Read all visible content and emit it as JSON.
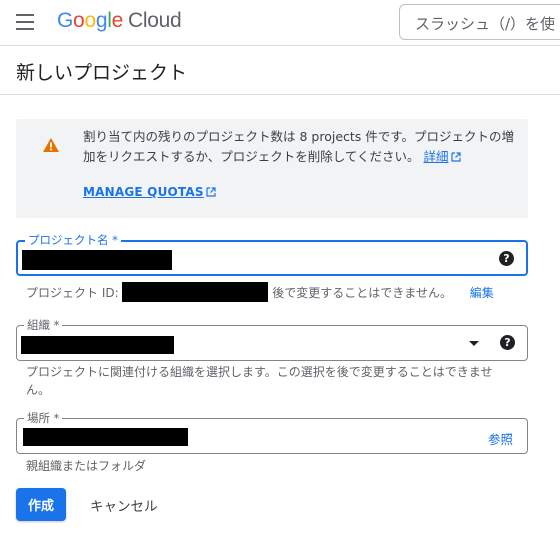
{
  "header": {
    "logo_google": [
      "G",
      "o",
      "o",
      "g",
      "l",
      "e"
    ],
    "logo_cloud": "Cloud",
    "search_placeholder": "スラッシュ（/）を使"
  },
  "page": {
    "title": "新しいプロジェクト"
  },
  "quota_notice": {
    "text": "割り当て内の残りのプロジェクト数は 8 projects 件です。プロジェクトの増加をリクエストするか、プロジェクトを削除してください。",
    "details_link": "詳細",
    "manage_link": "MANAGE QUOTAS",
    "icon": "warning-icon",
    "icon_color": "#e37400"
  },
  "form": {
    "project_name": {
      "label": "プロジェクト名 *",
      "value": ""
    },
    "project_id": {
      "label": "プロジェクト ID:",
      "value": "",
      "hint_suffix": "後で変更することはできません。",
      "edit_link": "編集"
    },
    "organization": {
      "label": "組織 *",
      "value": "",
      "hint": "プロジェクトに関連付ける組織を選択します。この選択を後で変更することはできません。"
    },
    "location": {
      "label": "場所 *",
      "value": "",
      "browse": "参照",
      "hint": "親組織またはフォルダ"
    }
  },
  "actions": {
    "create": "作成",
    "cancel": "キャンセル"
  },
  "colors": {
    "primary": "#1a73e8",
    "warning": "#e37400",
    "notice_bg": "#f1f3f4"
  }
}
